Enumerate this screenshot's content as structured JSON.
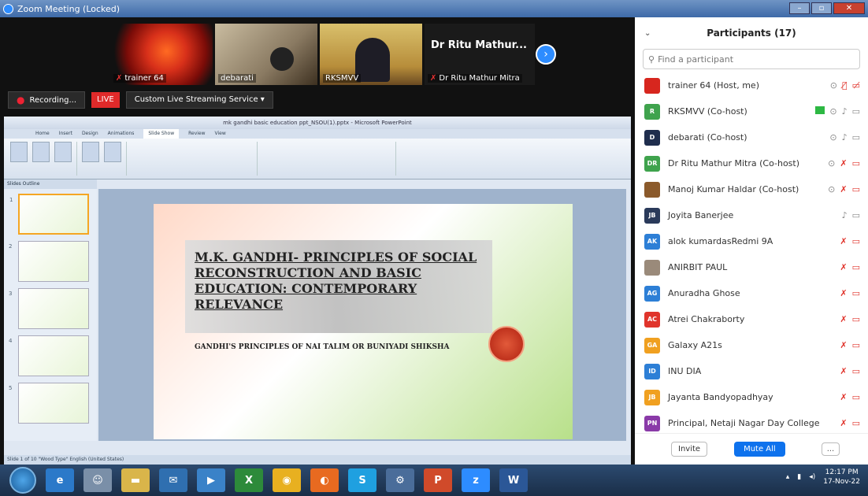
{
  "window": {
    "title": "Zoom Meeting (Locked)"
  },
  "video": {
    "tiles": [
      {
        "name": "trainer 64"
      },
      {
        "name": "debarati"
      },
      {
        "name": "RKSMVV"
      },
      {
        "name_large": "Dr Ritu Mathur...",
        "name": "Dr Ritu Mathur Mitra"
      }
    ]
  },
  "controls": {
    "recording": "Recording...",
    "live": "LIVE",
    "stream": "Custom Live Streaming Service"
  },
  "ppt": {
    "title": "mk gandhi basic education ppt_NSOU(1).pptx - Microsoft PowerPoint",
    "tabs": [
      "Home",
      "Insert",
      "Design",
      "Animations",
      "Slide Show",
      "Review",
      "View"
    ],
    "active_tab": "Slide Show",
    "pane_tabs": "Slides   Outline",
    "status": "Slide 1 of 10   \"Wood Type\"   English (United States)",
    "slide": {
      "title": "M.K. GANDHI- PRINCIPLES OF SOCIAL RECONSTRUCTION AND BASIC EDUCATION: CONTEMPORARY RELEVANCE",
      "subtitle": "GANDHI'S PRINCIPLES OF NAI TALIM OR BUNIYADI SHIKSHA"
    },
    "thumbnails": [
      "1",
      "2",
      "3",
      "4",
      "5"
    ]
  },
  "participants": {
    "header": "Participants (17)",
    "search_placeholder": "Find a participant",
    "list": [
      {
        "initials": "",
        "name": "trainer 64 (Host, me)",
        "color": "#d7261e"
      },
      {
        "initials": "R",
        "name": "RKSMVV (Co-host)",
        "color": "#3fa34d"
      },
      {
        "initials": "D",
        "name": "debarati (Co-host)",
        "color": "#1f2d4d"
      },
      {
        "initials": "DR",
        "name": "Dr Ritu Mathur Mitra (Co-host)",
        "color": "#3fa34d"
      },
      {
        "initials": "",
        "name": "Manoj Kumar Haldar (Co-host)",
        "color": "#8b5a2b"
      },
      {
        "initials": "JB",
        "name": "Joyita Banerjee",
        "color": "#2a3a5a"
      },
      {
        "initials": "AK",
        "name": "alok kumardasRedmi 9A",
        "color": "#2d7fd6"
      },
      {
        "initials": "",
        "name": "ANIRBIT PAUL",
        "color": "#9a8a7a"
      },
      {
        "initials": "AG",
        "name": "Anuradha Ghose",
        "color": "#2d7fd6"
      },
      {
        "initials": "AC",
        "name": "Atrei Chakraborty",
        "color": "#e0342b"
      },
      {
        "initials": "GA",
        "name": "Galaxy A21s",
        "color": "#f0a020"
      },
      {
        "initials": "ID",
        "name": "INU DIA",
        "color": "#2d7fd6"
      },
      {
        "initials": "JB",
        "name": "Jayanta Bandyopadhyay",
        "color": "#f0a020"
      },
      {
        "initials": "PN",
        "name": "Principal, Netaji Nagar Day College",
        "color": "#8a3aa8"
      }
    ],
    "invite": "Invite",
    "mute_all": "Mute All",
    "more": "..."
  },
  "taskbar": {
    "time": "12:17 PM",
    "date": "17-Nov-22"
  }
}
